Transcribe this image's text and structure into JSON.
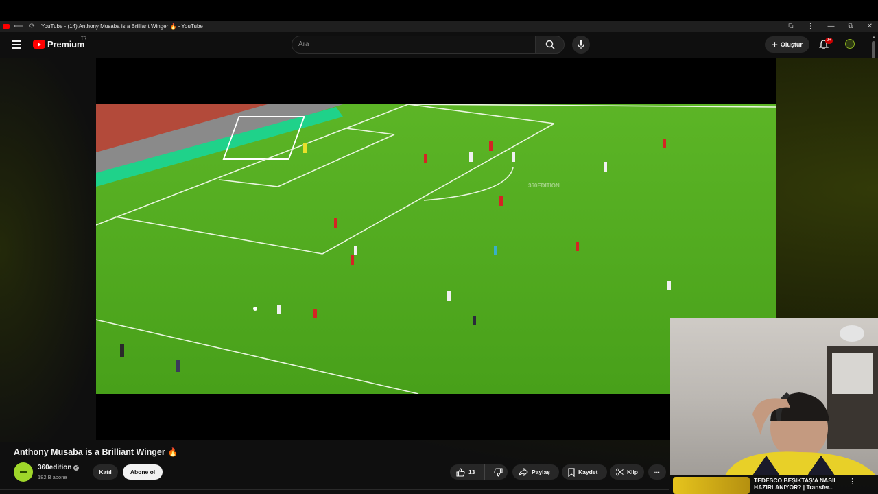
{
  "browser": {
    "tab_title": "YouTube - (14) Anthony Musaba is a Brilliant Winger 🔥 - YouTube",
    "back_icon": "back-arrow-icon",
    "reload_icon": "reload-icon",
    "extensions_icon": "extensions-icon",
    "menu_icon": "kebab-menu-icon",
    "minimize": "—",
    "restore": "⧉",
    "close": "✕"
  },
  "header": {
    "logo_text": "Premium",
    "country_code": "TR",
    "search_placeholder": "Ara",
    "create_label": "Oluştur",
    "notifications_badge": "9+"
  },
  "player": {
    "watermark": "360EDITION"
  },
  "video": {
    "title": "Anthony Musaba is a Brilliant Winger",
    "title_emoji": "🔥",
    "channel_name": "360edition",
    "subscribers": "182 B abone",
    "join_label": "Katıl",
    "subscribe_label": "Abone ol",
    "likes": "13",
    "share_label": "Paylaş",
    "save_label": "Kaydet",
    "clip_label": "Klip",
    "more_label": "···"
  },
  "recommendation": {
    "title": "TEDESCO BEŞİKTAŞ'A NASIL HAZIRLANIYOR? | Transfer..."
  },
  "colors": {
    "accent": "#ff0000",
    "pitch": "#4fa61d",
    "background": "#0f0f0f"
  }
}
